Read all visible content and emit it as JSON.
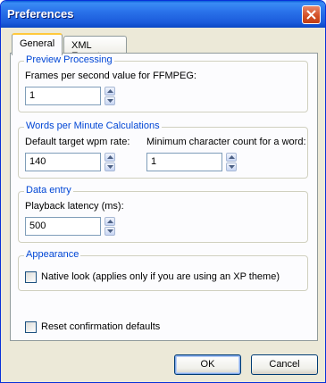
{
  "window": {
    "title": "Preferences"
  },
  "tabs": [
    {
      "label": "General",
      "selected": true
    },
    {
      "label": "XML Export",
      "selected": false
    }
  ],
  "preview_processing": {
    "legend": "Preview Processing",
    "fps_label": "Frames per second value for FFMPEG:",
    "fps_value": "1"
  },
  "wpm": {
    "legend": "Words per Minute Calculations",
    "target_label": "Default target wpm rate:",
    "target_value": "140",
    "min_char_label": "Minimum character count for a word:",
    "min_char_value": "1"
  },
  "data_entry": {
    "legend": "Data entry",
    "latency_label": "Playback latency (ms):",
    "latency_value": "500"
  },
  "appearance": {
    "legend": "Appearance",
    "native_look_label": "Native look (applies only if you are using an XP theme)",
    "native_look_checked": false
  },
  "reset": {
    "label": "Reset confirmation defaults",
    "checked": false
  },
  "buttons": {
    "ok": "OK",
    "cancel": "Cancel"
  },
  "colors": {
    "titlebar": "#0A5FD8",
    "legend_text": "#0046D5",
    "face": "#ECE9D8"
  }
}
